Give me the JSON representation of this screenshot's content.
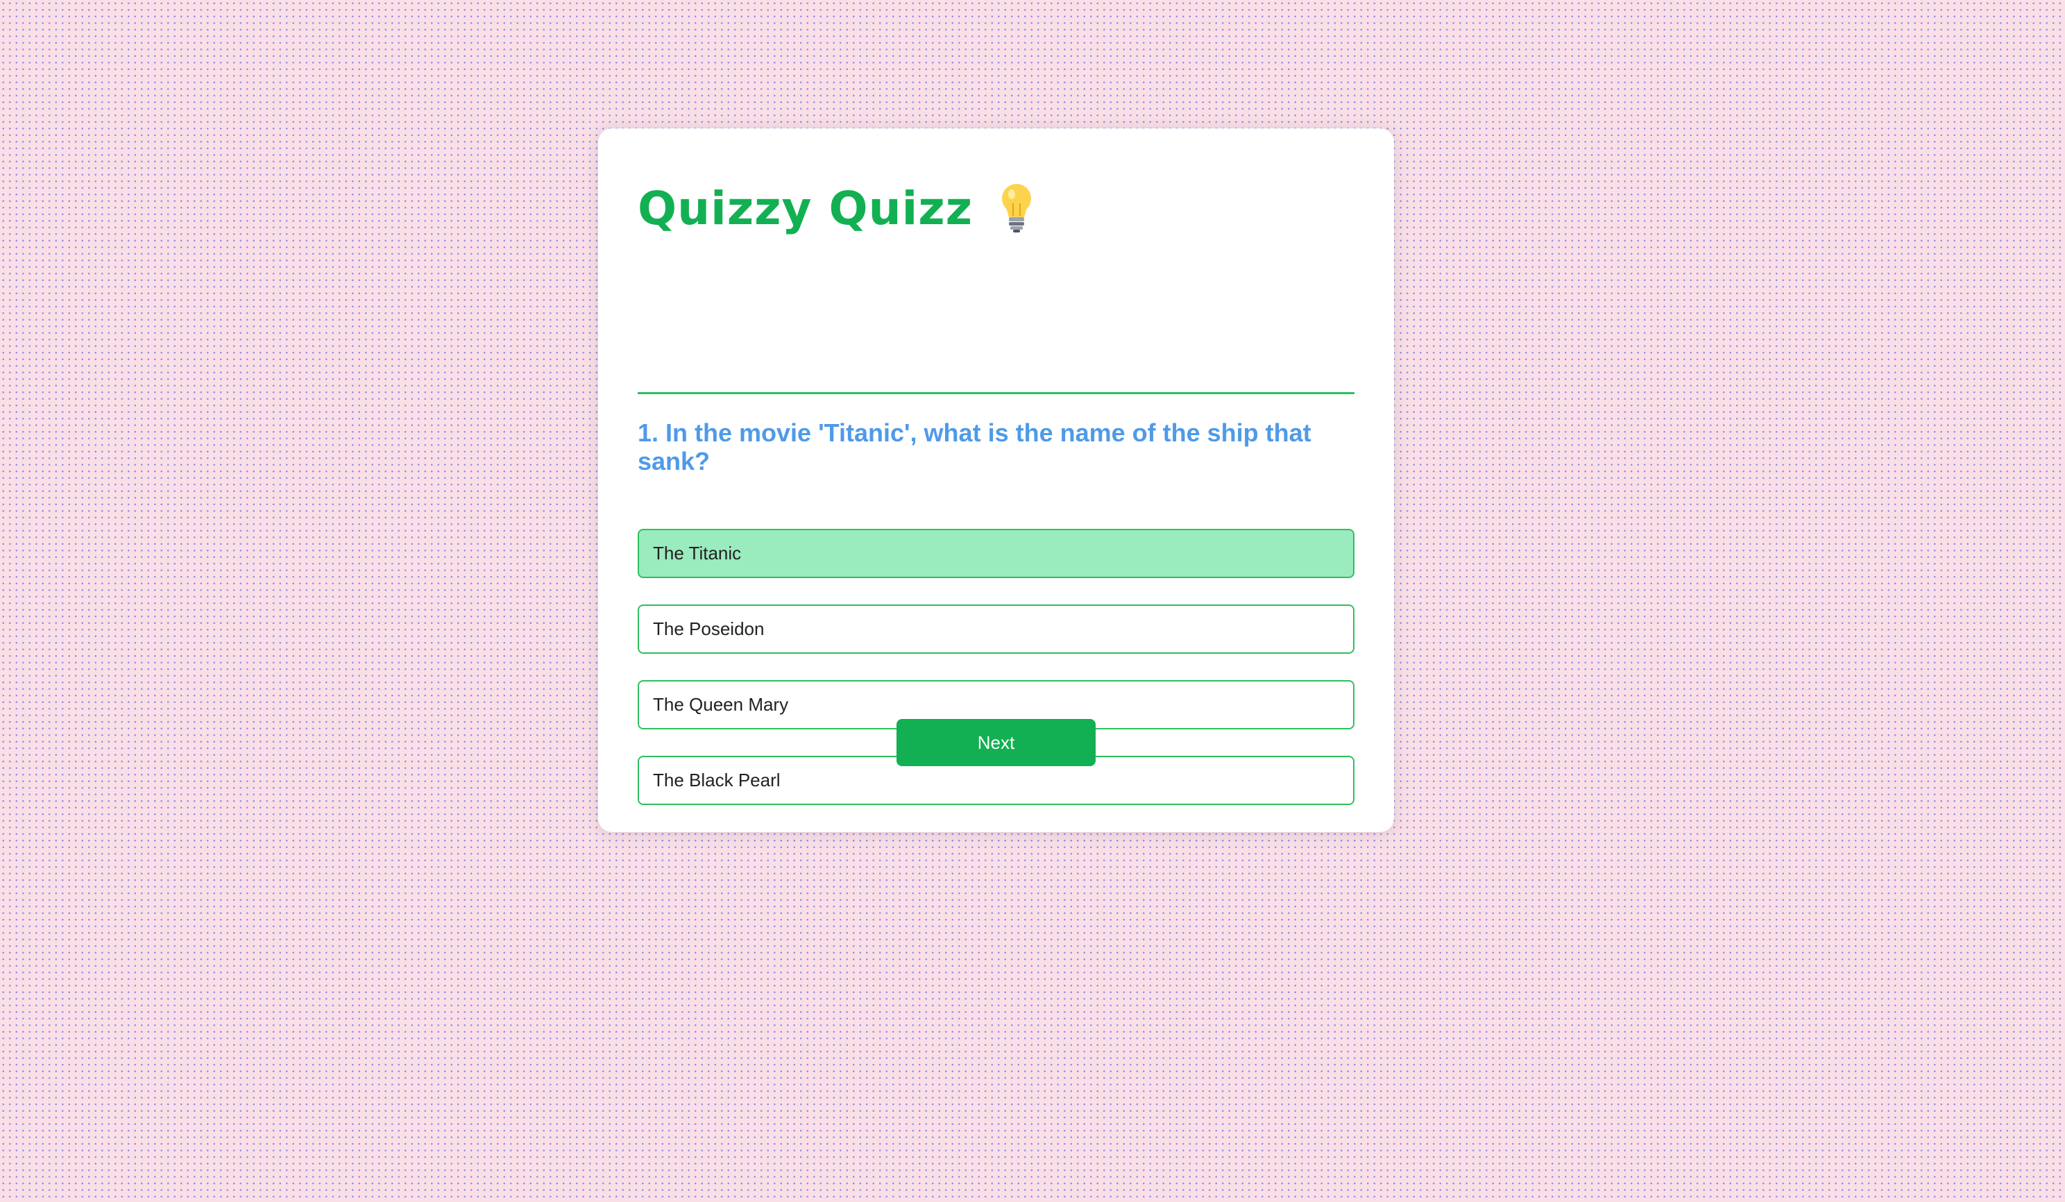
{
  "colors": {
    "accent_green": "#12b052",
    "question_blue": "#4f9ae8",
    "selected_answer_bg": "#9aebbd",
    "answer_border": "#2fbf5e"
  },
  "header": {
    "title": "Quizzy Quizz",
    "icon": "lightbulb-icon"
  },
  "question": {
    "text": "1. In the movie 'Titanic', what is the name of the ship that sank?"
  },
  "answers": [
    {
      "label": "The Titanic",
      "selected": true
    },
    {
      "label": "The Poseidon",
      "selected": false
    },
    {
      "label": "The Queen Mary",
      "selected": false
    },
    {
      "label": "The Black Pearl",
      "selected": false
    }
  ],
  "controls": {
    "next_label": "Next"
  }
}
